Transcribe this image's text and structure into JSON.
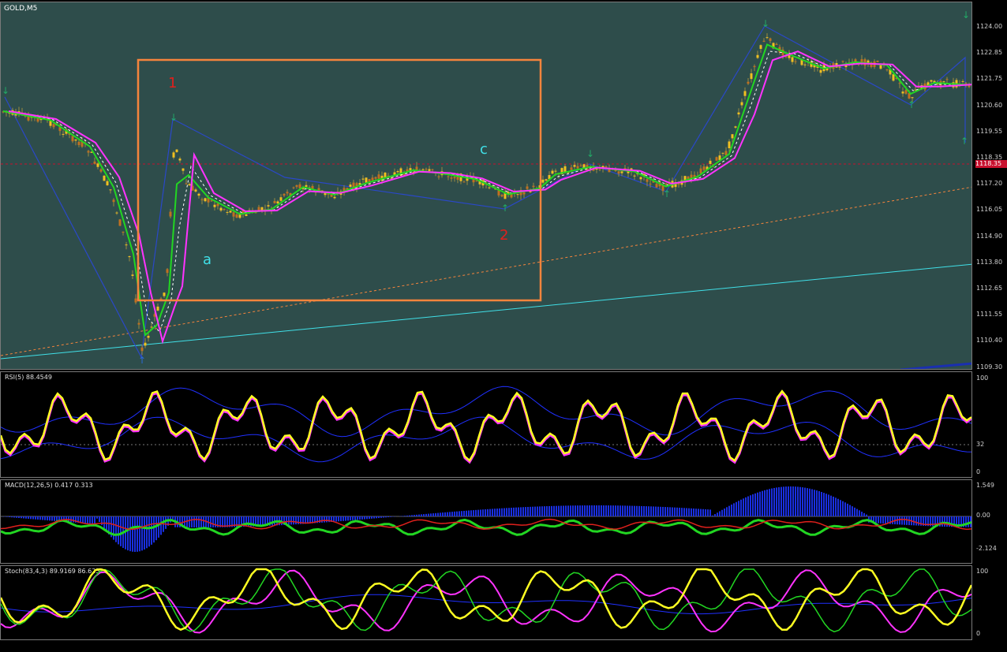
{
  "symbol_label": "GOLD,M5",
  "price_scale": [
    "1124.00",
    "1122.85",
    "1121.75",
    "1120.60",
    "1119.55",
    "1118.35",
    "1117.20",
    "1116.05",
    "1114.90",
    "1113.80",
    "1112.65",
    "1111.55",
    "1110.40",
    "1109.30"
  ],
  "current_price": "1118.35",
  "wave_labels": {
    "one": "1",
    "two": "2",
    "a": "a",
    "c": "c"
  },
  "rsi": {
    "label": "RSI(5) 88.4549",
    "scale": [
      "100",
      "32",
      "0"
    ]
  },
  "macd": {
    "label": "MACD(12,26,5) 0.417 0.313",
    "scale": [
      "1.549",
      "0.00",
      "-2.124"
    ]
  },
  "stoch": {
    "label": "Stoch(83,4,3) 89.9169 86.6251",
    "scale": [
      "100",
      "0"
    ]
  },
  "colors": {
    "chart_bg": "#2e4d4b",
    "box": "#f5843c",
    "wave_red": "#e0201c",
    "wave_cyan": "#40e0e8",
    "ma_fast": "#22d622",
    "ma_slow": "#ff33ff",
    "rsi_line": "#ffff22",
    "macd_hist": "#1a2fe0"
  }
}
